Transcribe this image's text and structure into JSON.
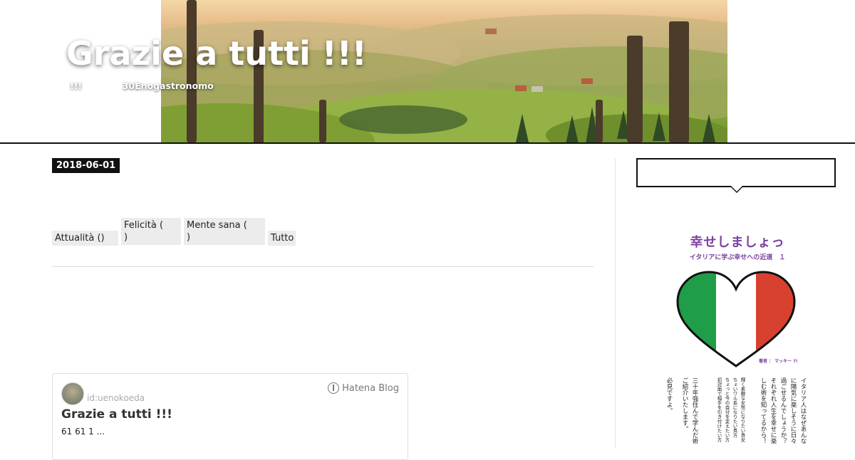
{
  "header": {
    "blog_title": "Grazie a tutti !!!",
    "blog_description": "!!!             30Enogastronomo"
  },
  "entry": {
    "date": "2018-06-01",
    "categories": [
      {
        "label": "Attualità ()"
      },
      {
        "label": "Felicità (\n)"
      },
      {
        "label": "Mente sana (\n)"
      },
      {
        "label": "Tutto"
      }
    ]
  },
  "embed": {
    "user": "id:uenokoeda",
    "logo": "Hatena Blog",
    "title": "Grazie a tutti !!!",
    "summary": "61  61  1 ..."
  },
  "sidebar": {
    "search": {
      "placeholder": ""
    },
    "book": {
      "title": "幸せしましょっ",
      "subtitle": "イタリアに学ぶ幸せへの近道　１",
      "author": "著者 ： マッキー ?!",
      "columns": [
        "イタリア人はなぜあんな",
        "に陽気に楽しそうに日々",
        "過ごせるんでしょうか？",
        "それぞれ人生を幸せに楽",
        "しむ術を知ってるから！",
        "",
        "輝く素敵な女性になりたい貴女",
        "ちょいワル系になりたい貴方",
        "ちょっと今の自分を変えたい方",
        "初対面で相手を引き付けたい方",
        "",
        "三十年強住んで学んだ術",
        "ご紹介いたします。",
        "",
        "必見ですよ。"
      ]
    }
  },
  "colors": {
    "header_border": "#111111",
    "date_badge_bg": "#111111",
    "category_bg": "#ececec",
    "book_accent": "#7b3fa0",
    "flag_green": "#1f9d48",
    "flag_red": "#d8412f"
  }
}
